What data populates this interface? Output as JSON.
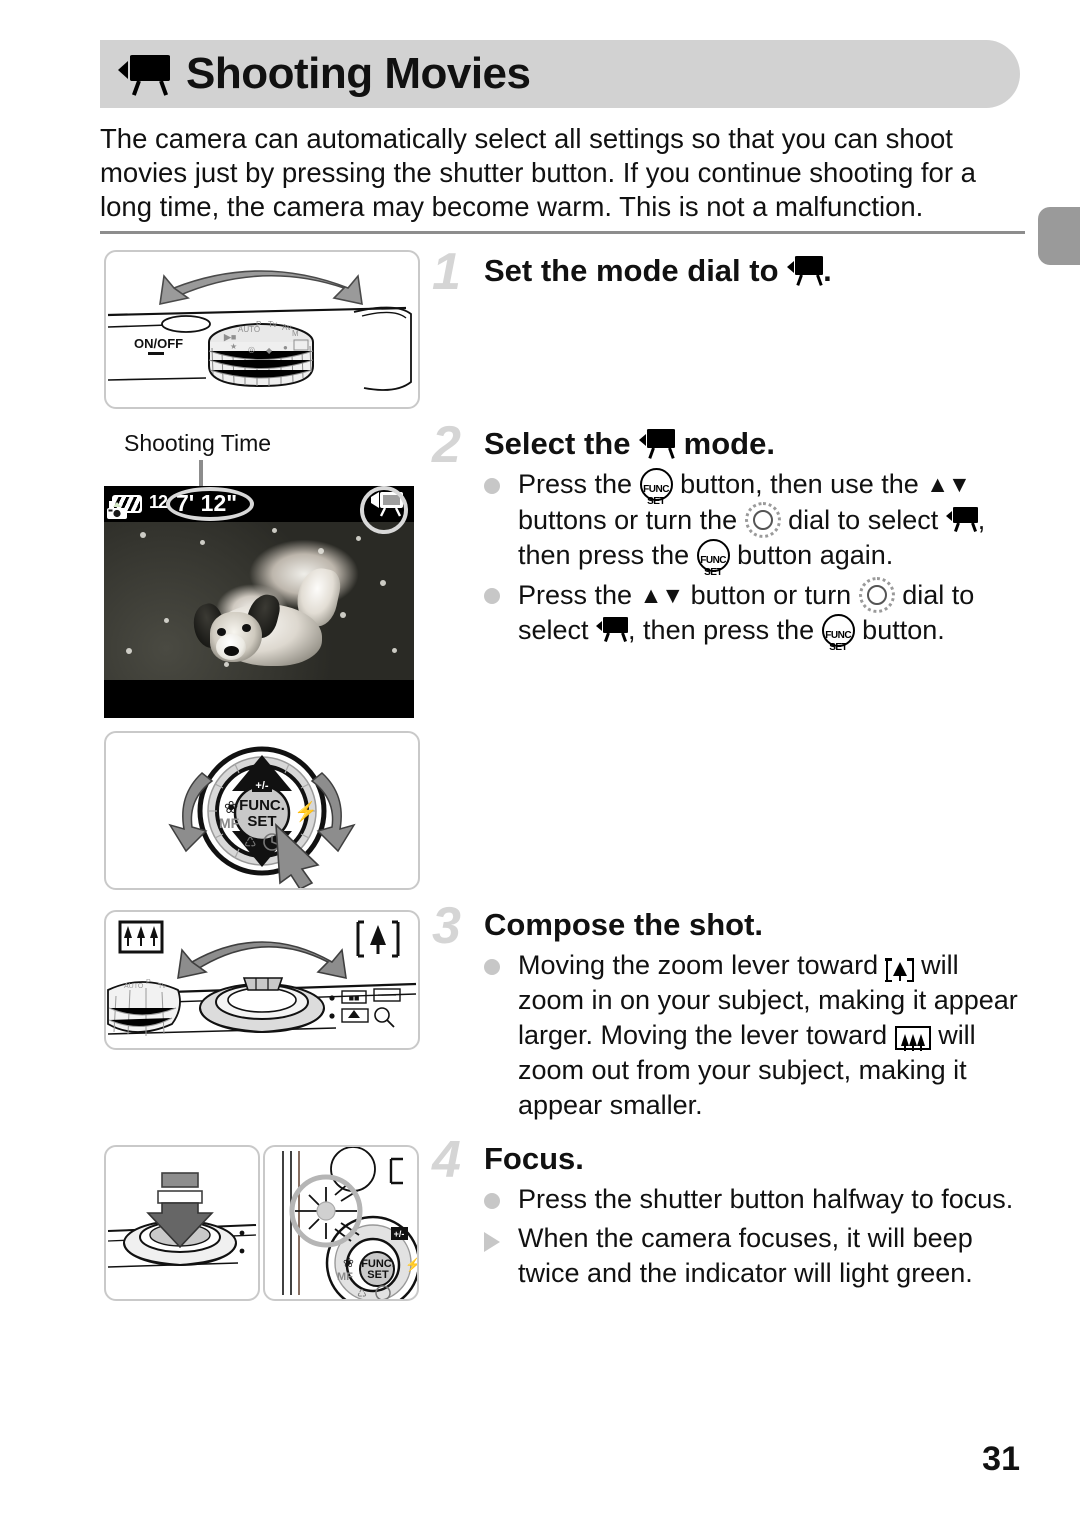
{
  "page": {
    "number": "31",
    "title": "Shooting Movies",
    "title_icon": "movie-mode-icon",
    "intro": "The camera can automatically select all settings so that you can shoot movies just by pressing the shutter button. If you continue shooting for a long time, the camera may become warm. This is not a malfunction."
  },
  "figures": {
    "mode_dial": {
      "name": "mode-dial-illustration",
      "on_off_label": "ON/OFF"
    },
    "lcd": {
      "name": "lcd-preview-screen",
      "callout_label": "Shooting Time",
      "shooting_time": "7' 12\"",
      "shots_remaining": "12",
      "battery_icon": "battery-full-icon",
      "mode_icon": "movie-mode-icon",
      "camera_icon": "still-camera-icon"
    },
    "func_dial": {
      "name": "func-set-dial-illustration",
      "func_label_top": "FUNC.",
      "func_label_bottom": "SET",
      "mf_label": "MF"
    },
    "zoom_lever": {
      "name": "zoom-lever-illustration",
      "wide_icon": "wide-angle-icon",
      "tele_icon": "telephoto-icon"
    },
    "shutter_press": {
      "name": "shutter-button-press-illustration"
    },
    "indicator": {
      "name": "indicator-lamp-illustration",
      "func_label_top": "FUNC.",
      "func_label_bottom": "SET",
      "mf_label": "MF"
    }
  },
  "steps": [
    {
      "number": "1",
      "heading_before": "Set the mode dial to ",
      "heading_icon": "movie-mode-icon",
      "heading_after": ".",
      "bullets": []
    },
    {
      "number": "2",
      "heading_before": "Select the ",
      "heading_icon": "movie-mode-icon",
      "heading_after": " mode.",
      "bullets": [
        {
          "marker": "dot",
          "parts": [
            "Press the ",
            "[func-set-button-icon]",
            " button, then use the ",
            "[up-down-buttons-icon]",
            " buttons or turn the ",
            "[control-dial-icon]",
            " dial to select ",
            "[movie-mode-icon]",
            ", then press the ",
            "[func-set-button-icon]",
            " button again."
          ]
        },
        {
          "marker": "dot",
          "parts": [
            "Press the ",
            "[up-down-buttons-icon]",
            " button or turn ",
            "[control-dial-icon]",
            " dial to select ",
            "[movie-mode-icon]",
            ", then press the ",
            "[func-set-button-icon]",
            " button."
          ]
        }
      ]
    },
    {
      "number": "3",
      "heading_before": "Compose the shot.",
      "heading_icon": "",
      "heading_after": "",
      "bullets": [
        {
          "marker": "dot",
          "parts": [
            "Moving the zoom lever toward ",
            "[telephoto-icon]",
            " will zoom in on your subject, making it appear larger. Moving the lever toward ",
            "[wide-angle-icon]",
            " will zoom out from your subject, making it appear smaller."
          ]
        }
      ]
    },
    {
      "number": "4",
      "heading_before": "Focus.",
      "heading_icon": "",
      "heading_after": "",
      "bullets": [
        {
          "marker": "dot",
          "parts": [
            "Press the shutter button halfway to focus."
          ]
        },
        {
          "marker": "triangle",
          "parts": [
            "When the camera focuses, it will beep twice and the indicator will light green."
          ]
        }
      ]
    }
  ],
  "text": {
    "step1_heading_before": "Set the mode dial to ",
    "step1_heading_after": ".",
    "step2_heading_before": "Select the ",
    "step2_heading_after": " mode.",
    "step3_heading": "Compose the shot.",
    "step4_heading": "Focus.",
    "s2b1_p1": "Press the ",
    "s2b1_p2": " button, then use the ",
    "s2b1_p3": " buttons or turn the ",
    "s2b1_p4": " dial to select ",
    "s2b1_p5": ", then press the ",
    "s2b1_p6": " button again.",
    "s2b2_p1": "Press the ",
    "s2b2_p2": " button or turn ",
    "s2b2_p3": " dial to select ",
    "s2b2_p4": ", then press the ",
    "s2b2_p5": " button.",
    "s3b1_p1": "Moving the zoom lever toward ",
    "s3b1_p2": " will zoom in on your subject, making it appear larger. Moving the lever toward ",
    "s3b1_p3": " will zoom out from your subject, making it appear smaller.",
    "s4b1": "Press the shutter button halfway to focus.",
    "s4b2": "When the camera focuses, it will beep twice and the indicator will light green."
  },
  "colors": {
    "header_bar": "#d2d2d2",
    "step_number": "#d5d5d5",
    "bullet": "#c7c7c7",
    "rule": "#8d8d8d",
    "edge_tab": "#9a9a9a",
    "figure_border": "#c9c9c9"
  }
}
